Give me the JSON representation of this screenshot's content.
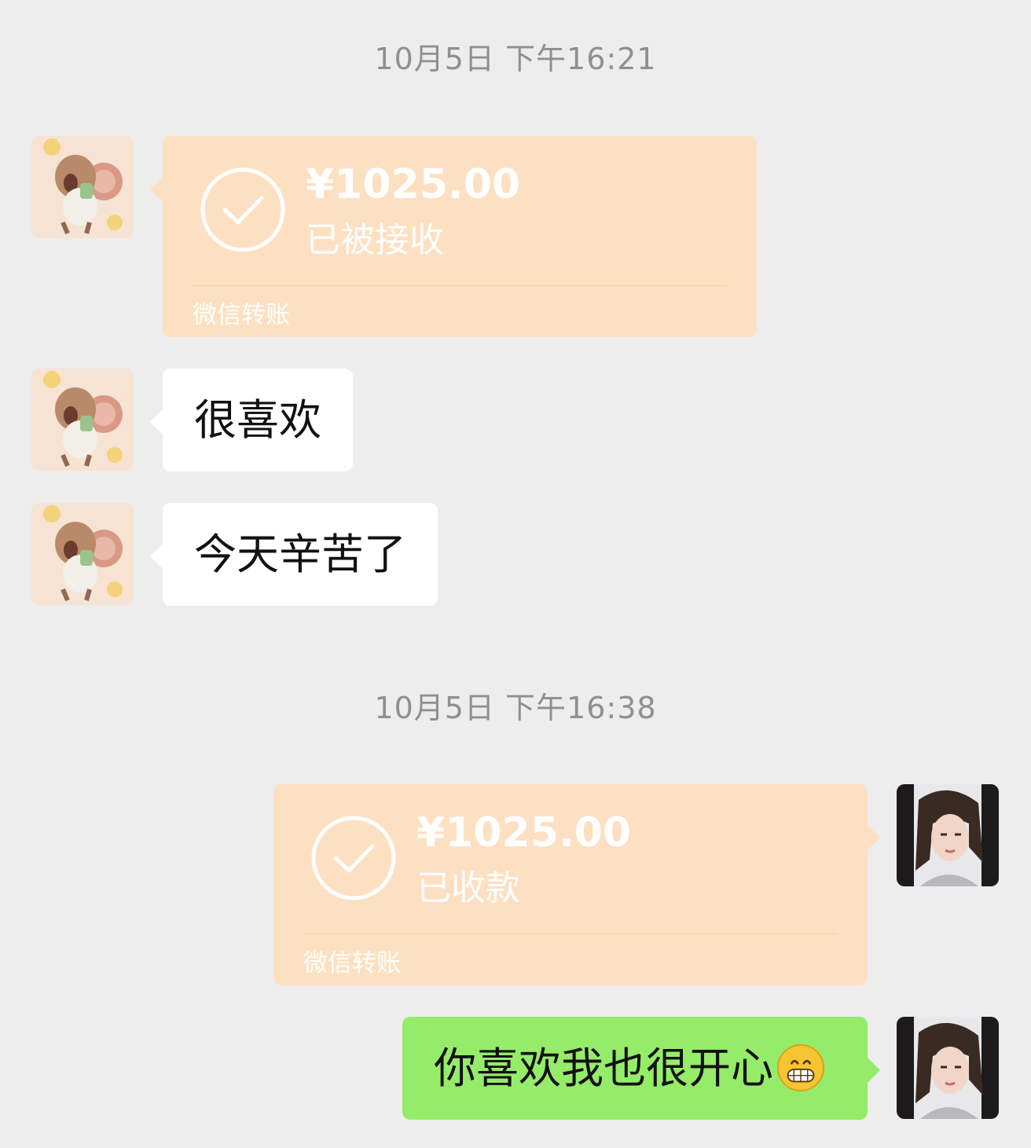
{
  "timestamps": [
    "10月5日 下午16:21",
    "10月5日 下午16:38"
  ],
  "messages": {
    "m1": {
      "amount": "¥1025.00",
      "status": "已被接收",
      "footer": "微信转账"
    },
    "m2": {
      "text": "很喜欢"
    },
    "m3": {
      "text": "今天辛苦了"
    },
    "m4": {
      "amount": "¥1025.00",
      "status": "已收款",
      "footer": "微信转账"
    },
    "m5": {
      "text": "你喜欢我也很开心"
    }
  },
  "colors": {
    "background": "#ededed",
    "transfer_bubble": "#fde0c1",
    "sent_bubble": "#95ec69",
    "received_bubble": "#ffffff",
    "timestamp_text": "#8f8f8f"
  },
  "icons": {
    "contact_avatar": "cartoon-mouse-avatar",
    "self_avatar": "woman-portrait-avatar",
    "transfer_status": "check-circle-icon",
    "emoji": "grinning-face-emoji"
  }
}
